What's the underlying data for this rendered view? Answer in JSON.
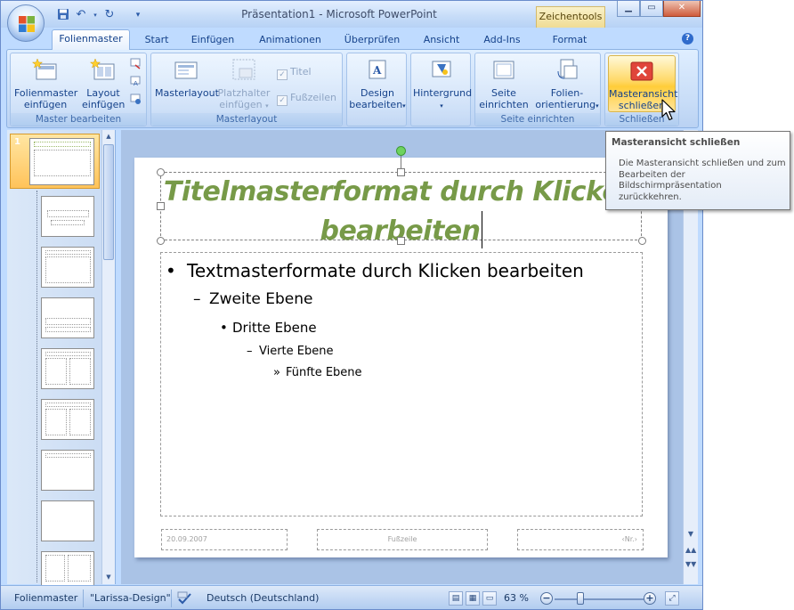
{
  "window": {
    "title_left": "Präsentation1",
    "title_sep": "-",
    "title_app": "Microsoft PowerPoint",
    "context_tab": "Zeichentools"
  },
  "tabs": [
    "Folienmaster",
    "Start",
    "Einfügen",
    "Animationen",
    "Überprüfen",
    "Ansicht",
    "Add-Ins",
    "Format"
  ],
  "ribbon": {
    "groups": {
      "master": "Master bearbeiten",
      "layout": "Masterlayout",
      "edit": "Seite einrichten",
      "close": "Schließen"
    },
    "buttons": {
      "insert_master": [
        "Folienmaster",
        "einfügen"
      ],
      "insert_layout": [
        "Layout",
        "einfügen"
      ],
      "masterlayout": "Masterlayout",
      "placeholder": [
        "Platzhalter",
        "einfügen"
      ],
      "title_check": "Titel",
      "footer_check": "Fußzeilen",
      "design": [
        "Design",
        "bearbeiten"
      ],
      "background": "Hintergrund",
      "page_setup": [
        "Seite",
        "einrichten"
      ],
      "orientation": [
        "Folien-",
        "orientierung"
      ],
      "close_master": [
        "Masteransicht",
        "schließen"
      ]
    }
  },
  "tooltip": {
    "title": "Masteransicht schließen",
    "description": "Die Masteransicht schließen und zum Bearbeiten der Bildschirmpräsentation zurückkehren."
  },
  "thumbnails": {
    "selected_number": "1"
  },
  "slide": {
    "title_line1": "Titelmasterformat durch Klicken",
    "title_line2": "bearbeiten",
    "levels": {
      "l1": "Textmasterformate durch Klicken bearbeiten",
      "l2": "Zweite Ebene",
      "l3": "Dritte Ebene",
      "l4": "Vierte Ebene",
      "l5": "Fünfte Ebene"
    },
    "bullets": {
      "l1": "•",
      "l2": "–",
      "l3": "•",
      "l4": "–",
      "l5": "»"
    },
    "footer_date": "20.09.2007",
    "footer_center": "Fußzeile",
    "footer_number": "‹Nr.›"
  },
  "statusbar": {
    "mode": "Folienmaster",
    "theme": "\"Larissa-Design\"",
    "language": "Deutsch (Deutschland)",
    "zoom": "63 %"
  },
  "colors": {
    "title_green": "#779a48",
    "ribbon_blue": "#bfdbff",
    "highlight": "#ffd866"
  },
  "icons": [
    "office-logo-icon",
    "save-icon",
    "undo-icon",
    "redo-icon",
    "spellcheck-icon",
    "close-red-x-icon",
    "help-icon"
  ]
}
